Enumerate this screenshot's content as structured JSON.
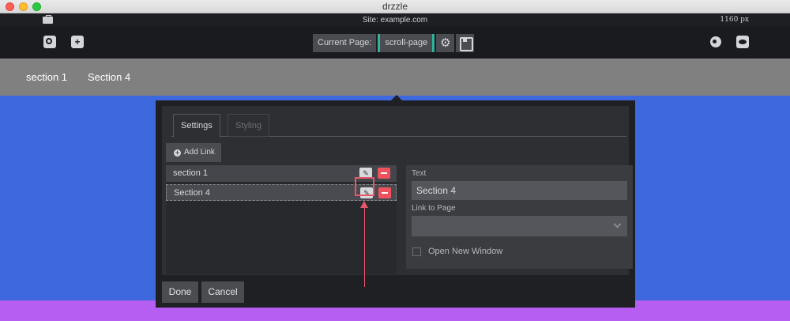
{
  "window": {
    "app_title": "drzzle"
  },
  "sitebar": {
    "site": "Site: example.com",
    "width": "1160 px"
  },
  "toolbar": {
    "current_page_label": "Current Page:",
    "current_page_value": "scroll-page",
    "settings_glyph": "⚙"
  },
  "pagenav": {
    "links": [
      "section 1",
      "Section 4"
    ]
  },
  "modal": {
    "tabs": [
      "Settings",
      "Styling"
    ],
    "add_link_label": "Add Link",
    "links": [
      {
        "label": "section 1"
      },
      {
        "label": "Section 4"
      }
    ],
    "edit_glyph": "✎",
    "text_field_label": "Text",
    "text_value": "Section 4",
    "link_to_page_label": "Link to Page",
    "link_to_page_value": "",
    "open_new_window_label": "Open New Window",
    "open_new_window_checked": false,
    "done_label": "Done",
    "cancel_label": "Cancel"
  },
  "colors": {
    "background_blue": "#3e68de",
    "purple_section": "#b65ef2",
    "accent_teal": "#2fb39a",
    "remove_red": "#f0525d",
    "annotation_red": "#e8566a"
  }
}
